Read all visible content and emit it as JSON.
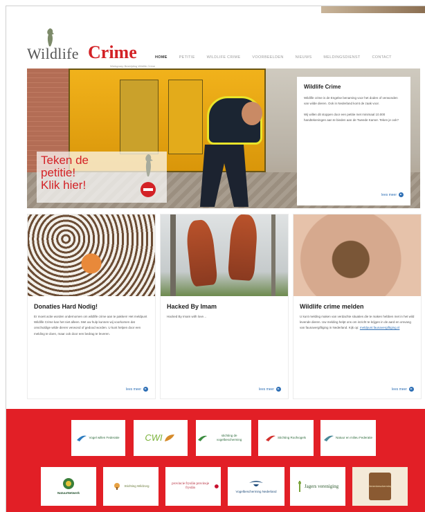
{
  "logo": {
    "wordmark_1": "Wildlife",
    "wordmark_2": "Crime",
    "tagline": "Werkgroep Bestrijding Wildlife Crime"
  },
  "nav": [
    "HOME",
    "PETITIE",
    "WILDLIFE CRIME",
    "VOORBEELDEN",
    "NIEUWS",
    "MELDINGSDIENST",
    "CONTACT"
  ],
  "petition": {
    "text": "Teken de\npetitie!\nKlik hier!"
  },
  "hero_card": {
    "title": "Wildlife Crime",
    "p1": "Wildlife crime is de Engelse benaming voor het doden of verwonden van wilde dieren. Ook in Nederland komt de zaak voor.",
    "p2": "Wij willen dit stoppen door een petitie met minimaal 10.000 handtekeningen aan te bieden aan de Tweede Kamer. Teken je ook?",
    "more": "lees meer"
  },
  "cards": [
    {
      "title": "Donaties Hard Nodig!",
      "body": "Er moeit actie worden ondernomen om wildlife crime aan te pakken! Het meldpunt Wildlife Crime kan het niet alleen. Met uw hulp kunnen wij voorkomen dat onschuldige wilde dieren verwond of gedood worden. U kunt helpen door een melding te doen, maar ook door een bedrag te leveren.",
      "more": "lees meer"
    },
    {
      "title": "Hacked By Imam",
      "body": "Hacked By Imam with love…",
      "more": "lees meer"
    },
    {
      "title": "Wildlife crime melden",
      "body": "U kunt melding maken van verdachte situaties die te maken hebben met in het wild levende dieren. Uw melding helpt ons om inzicht te krijgen in de aard en omvang van faunavergiftiging in Nederland. Kijk op:",
      "link": "meldpunt.faunavergiftiging.nl",
      "more": "lees meer"
    }
  ],
  "sponsors_row1": [
    "Vogel willen Federatie",
    "CWI",
    "stichting de vogelbescherming",
    "Stichting Roofvogels",
    "Natuur en milieu Federatie"
  ],
  "sponsors_row2": [
    "NatuurNetwerk",
    "Stichting Wildzorg",
    "provincie fryslân provinsje fryslân",
    "Vogelbescherming Nederland",
    "Jagers vereniging",
    "Dierenbescherming"
  ],
  "colors": {
    "brand_red": "#d32226",
    "footer_red": "#e21f26",
    "link_blue": "#2e6fb5"
  }
}
